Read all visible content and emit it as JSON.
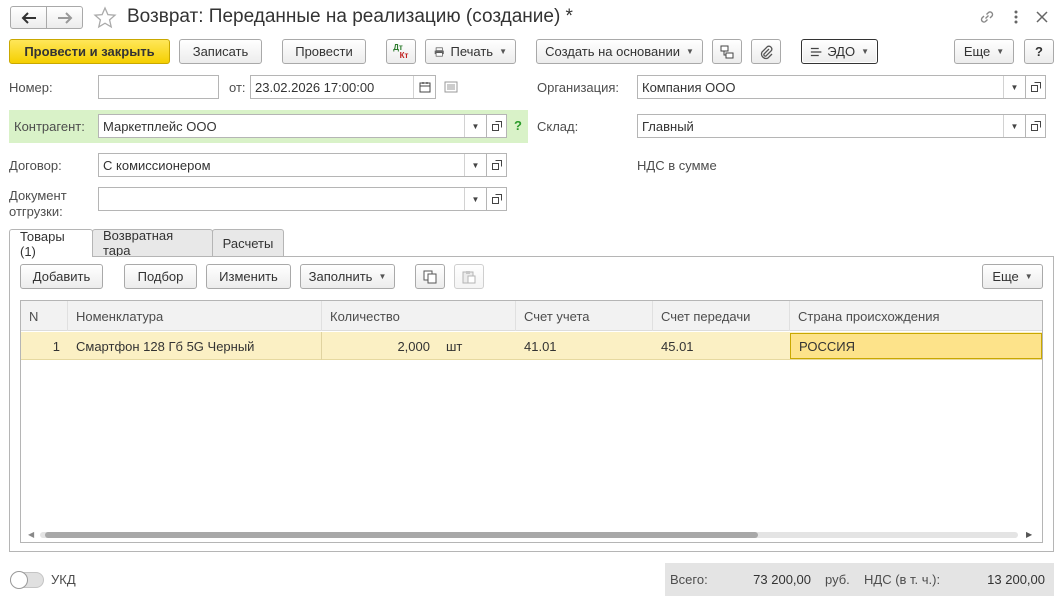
{
  "window": {
    "title": "Возврат: Переданные на реализацию (создание) *"
  },
  "toolbar": {
    "post_and_close": "Провести и закрыть",
    "save": "Записать",
    "post": "Провести",
    "dt_kt_top": "Дт",
    "dt_kt_bottom": "Кт",
    "print": "Печать",
    "create_based_on": "Создать на основании",
    "edo": "ЭДО",
    "more": "Еще",
    "help": "?"
  },
  "header_form": {
    "number_label": "Номер:",
    "number_value": "",
    "date_label": "от:",
    "date_value": "23.02.2026 17:00:00",
    "counterparty_label": "Контрагент:",
    "counterparty_value": "Маркетплейс ООО",
    "counterparty_hint": "?",
    "contract_label": "Договор:",
    "contract_value": "С комиссионером",
    "shipment_doc_label_1": "Документ",
    "shipment_doc_label_2": "отгрузки:",
    "shipment_doc_value": "",
    "organization_label": "Организация:",
    "organization_value": "Компания ООО",
    "warehouse_label": "Склад:",
    "warehouse_value": "Главный",
    "vat_mode_link": "НДС в сумме"
  },
  "tabs": [
    {
      "label": "Товары (1)",
      "active": true
    },
    {
      "label": "Возвратная тара",
      "active": false
    },
    {
      "label": "Расчеты",
      "active": false
    }
  ],
  "table_toolbar": {
    "add": "Добавить",
    "pick": "Подбор",
    "edit": "Изменить",
    "fill": "Заполнить",
    "more": "Еще"
  },
  "table": {
    "columns": [
      "N",
      "Номенклатура",
      "Количество",
      "Счет учета",
      "Счет передачи",
      "Страна происхождения"
    ],
    "rows": [
      {
        "n": "1",
        "item": "Смартфон 128 Гб 5G Черный",
        "qty": "2,000",
        "unit": "шт",
        "account": "41.01",
        "transfer_account": "45.01",
        "country": "РОССИЯ"
      }
    ]
  },
  "footer": {
    "ukd_label": "УКД",
    "total_label": "Всего:",
    "total_value": "73 200,00",
    "currency": "руб.",
    "vat_label": "НДС (в т. ч.):",
    "vat_value": "13 200,00"
  },
  "colors": {
    "primary_button": "#f5cf00",
    "selected_row": "#fbf0c4",
    "counterparty_highlight": "#d9f2c8",
    "link_green": "#2a9a2a"
  }
}
